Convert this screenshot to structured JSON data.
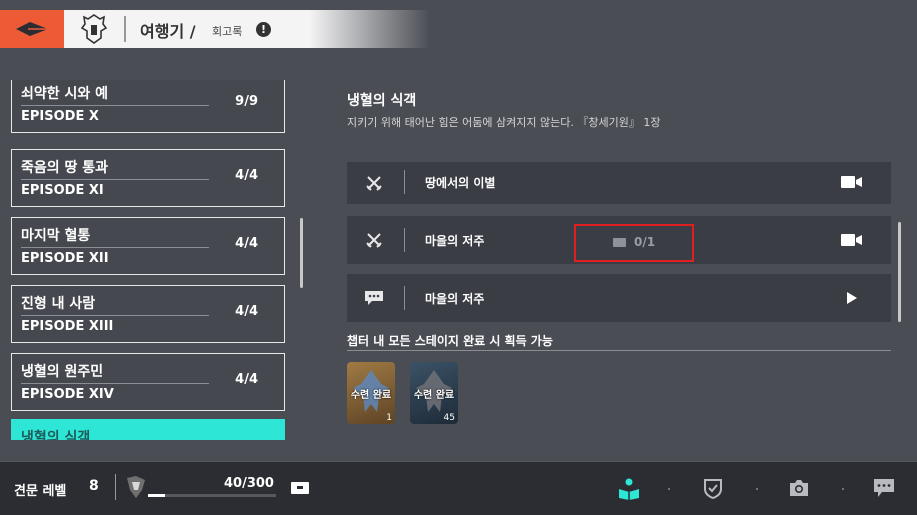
{
  "header": {
    "title": "여행기 /",
    "subtitle": "회고록",
    "info_icon": "!"
  },
  "episodes": [
    {
      "name": "쇠약한 시와 예",
      "episode": "EPISODE X",
      "progress": "9/9"
    },
    {
      "name": "죽음의 땅 통과",
      "episode": "EPISODE XI",
      "progress": "4/4"
    },
    {
      "name": "마지막 혈통",
      "episode": "EPISODE XII",
      "progress": "4/4"
    },
    {
      "name": "진형 내 사람",
      "episode": "EPISODE XIII",
      "progress": "4/4"
    },
    {
      "name": "냉혈의 원주민",
      "episode": "EPISODE XIV",
      "progress": "4/4"
    },
    {
      "name": "냉혈의 식객",
      "episode": "",
      "progress": "",
      "active": true
    }
  ],
  "chapter": {
    "title": "냉혈의 식객",
    "quote": "지키기 위해 태어난 힘은 어둠에 삼켜지지 않는다. 『창세기원』 1장"
  },
  "stages": [
    {
      "icon": "crossed-swords-icon",
      "label": "땅에서의 이별",
      "action": "video-camera-icon"
    },
    {
      "icon": "crossed-swords-icon",
      "label": "마을의 저주",
      "action": "video-camera-icon",
      "progress": "0/1"
    },
    {
      "icon": "chat-bubble-icon",
      "label": "마을의 저주",
      "action": "play-icon"
    }
  ],
  "rewards": {
    "title": "챕터 내 모든 스테이지 완료 시 획득 가능",
    "items": [
      {
        "label": "수련 완료",
        "count": "1",
        "color": "#8a6a3a"
      },
      {
        "label": "수련 완료",
        "count": "45",
        "color": "#2c3e4f"
      }
    ]
  },
  "footer": {
    "level_label": "견문 레벨",
    "level": "8",
    "xp": "40/300",
    "xp_fraction": 0.133,
    "nav_icons": [
      "book-reader-icon",
      "shield-check-icon",
      "camera-icon",
      "chat-icon"
    ],
    "accent": "#2ee6d6"
  }
}
